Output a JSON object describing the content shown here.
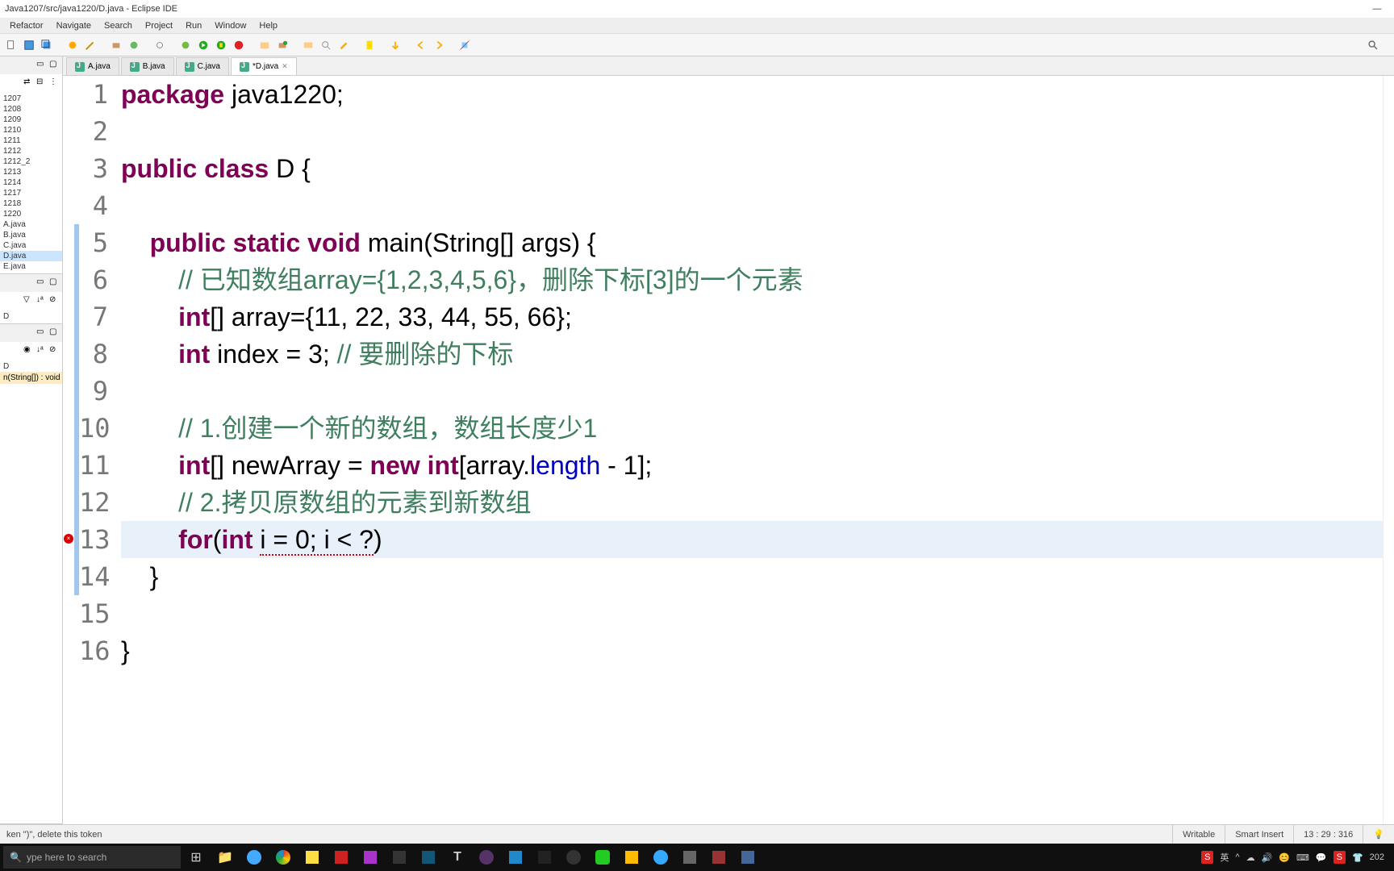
{
  "window": {
    "title": "Java1207/src/java1220/D.java - Eclipse IDE"
  },
  "menu": [
    "Refactor",
    "Navigate",
    "Search",
    "Project",
    "Run",
    "Window",
    "Help"
  ],
  "tabs": [
    {
      "label": "A.java",
      "active": false
    },
    {
      "label": "B.java",
      "active": false
    },
    {
      "label": "C.java",
      "active": false
    },
    {
      "label": "*D.java",
      "active": true
    }
  ],
  "packages": [
    "1207",
    "1208",
    "1209",
    "1210",
    "1211",
    "1212",
    "1212_2",
    "1213",
    "1214",
    "1217",
    "1218",
    "1220",
    "A.java",
    "B.java",
    "C.java",
    "D.java",
    "E.java"
  ],
  "packages_selected": "D.java",
  "outline": {
    "method": "n(String[]) : void",
    "class_item": "D"
  },
  "code_lines": [
    {
      "n": 1,
      "tokens": [
        {
          "t": "package ",
          "c": "kw"
        },
        {
          "t": "java1220;",
          "c": "id"
        }
      ]
    },
    {
      "n": 2,
      "tokens": []
    },
    {
      "n": 3,
      "tokens": [
        {
          "t": "public class ",
          "c": "kw"
        },
        {
          "t": "D {",
          "c": "id"
        }
      ]
    },
    {
      "n": 4,
      "tokens": []
    },
    {
      "n": 5,
      "tokens": [
        {
          "t": "    ",
          "c": "id"
        },
        {
          "t": "public static void ",
          "c": "kw"
        },
        {
          "t": "main(String[] args) {",
          "c": "id"
        }
      ]
    },
    {
      "n": 6,
      "tokens": [
        {
          "t": "        ",
          "c": "id"
        },
        {
          "t": "// 已知数组array={1,2,3,4,5,6}，删除下标[3]的一个元素",
          "c": "cm"
        }
      ]
    },
    {
      "n": 7,
      "tokens": [
        {
          "t": "        ",
          "c": "id"
        },
        {
          "t": "int",
          "c": "kw"
        },
        {
          "t": "[] array={11, 22, 33, 44, 55, 66};",
          "c": "id"
        }
      ]
    },
    {
      "n": 8,
      "tokens": [
        {
          "t": "        ",
          "c": "id"
        },
        {
          "t": "int ",
          "c": "kw"
        },
        {
          "t": "index = 3; ",
          "c": "id"
        },
        {
          "t": "// 要删除的下标",
          "c": "cm"
        }
      ]
    },
    {
      "n": 9,
      "tokens": []
    },
    {
      "n": 10,
      "tokens": [
        {
          "t": "        ",
          "c": "id"
        },
        {
          "t": "// 1.创建一个新的数组，数组长度少1",
          "c": "cm"
        }
      ]
    },
    {
      "n": 11,
      "tokens": [
        {
          "t": "        ",
          "c": "id"
        },
        {
          "t": "int",
          "c": "kw"
        },
        {
          "t": "[] newArray = ",
          "c": "id"
        },
        {
          "t": "new int",
          "c": "kw"
        },
        {
          "t": "[array.",
          "c": "id"
        },
        {
          "t": "length",
          "c": "field"
        },
        {
          "t": " - 1];",
          "c": "id"
        }
      ]
    },
    {
      "n": 12,
      "tokens": [
        {
          "t": "        ",
          "c": "id"
        },
        {
          "t": "// 2.拷贝原数组的元素到新数组",
          "c": "cm"
        }
      ]
    },
    {
      "n": 13,
      "tokens": [
        {
          "t": "        ",
          "c": "id"
        },
        {
          "t": "for",
          "c": "kw"
        },
        {
          "t": "(",
          "c": "id"
        },
        {
          "t": "int ",
          "c": "kw"
        },
        {
          "t": "i = 0; i < ?",
          "c": "id",
          "err": true
        },
        {
          "t": ")",
          "c": "id"
        }
      ],
      "current": true,
      "error": true
    },
    {
      "n": 14,
      "tokens": [
        {
          "t": "    }",
          "c": "id"
        }
      ]
    },
    {
      "n": 15,
      "tokens": []
    },
    {
      "n": 16,
      "tokens": [
        {
          "t": "}",
          "c": "id"
        }
      ]
    }
  ],
  "highlight_range": {
    "start": 5,
    "end": 14
  },
  "status": {
    "message": "ken \")\", delete this token",
    "writable": "Writable",
    "insert": "Smart Insert",
    "pos": "13 : 29 : 316"
  },
  "taskbar": {
    "search_placeholder": "ype here to search",
    "ime": "英",
    "clock": "202"
  },
  "tray_red_label": "S"
}
